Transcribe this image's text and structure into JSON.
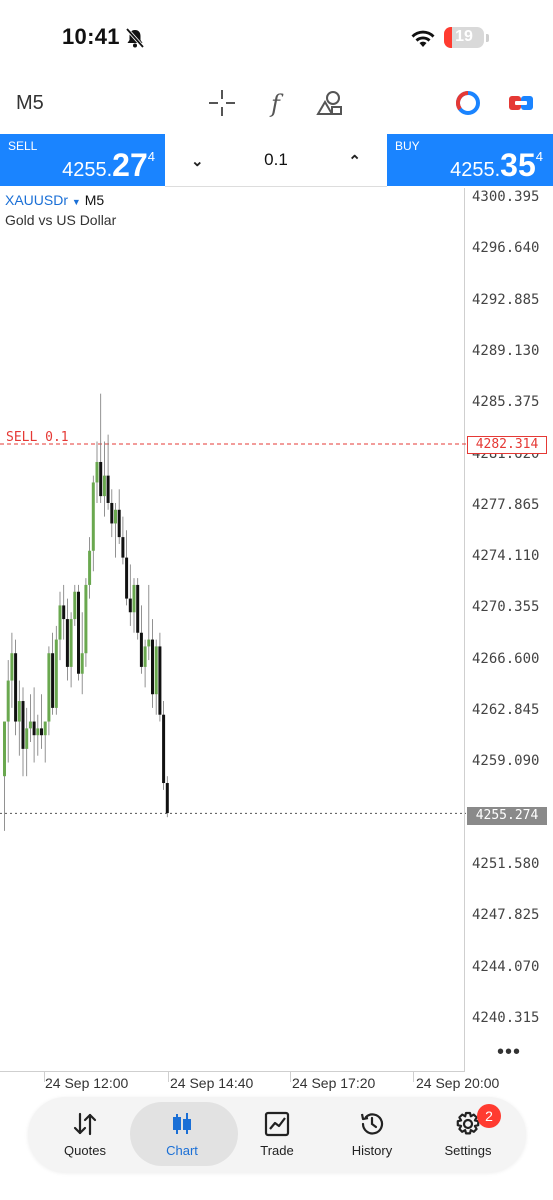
{
  "status_bar": {
    "time": "10:41",
    "battery": "19"
  },
  "toolbar": {
    "timeframe": "M5"
  },
  "trade": {
    "sell": {
      "label": "SELL",
      "price_a": "4255.",
      "price_b": "27",
      "price_c": "4"
    },
    "buy": {
      "label": "BUY",
      "price_a": "4255.",
      "price_b": "35",
      "price_c": "4"
    },
    "lot": "0.1"
  },
  "chart_data": {
    "type": "candlestick",
    "symbol": "XAUUSDr",
    "timeframe": "M5",
    "description": "Gold vs US Dollar",
    "y_ticks": [
      "4300.395",
      "4296.640",
      "4292.885",
      "4289.130",
      "4285.375",
      "4281.620",
      "4277.865",
      "4274.110",
      "4270.355",
      "4266.600",
      "4262.845",
      "4259.090",
      "4255.274",
      "4251.580",
      "4247.825",
      "4244.070",
      "4240.315"
    ],
    "y_range": [
      4238.0,
      4301.0
    ],
    "x_ticks": [
      "24 Sep 12:00",
      "24 Sep 14:40",
      "24 Sep 17:20",
      "24 Sep 20:00"
    ],
    "sell_order": {
      "label": "SELL 0.1",
      "price": "4282.314",
      "value": 4282.314
    },
    "current_price": {
      "label": "4255.274",
      "value": 4255.274
    },
    "candles": [
      [
        4258.0,
        4262.0,
        4254.0,
        4262.0
      ],
      [
        4262.0,
        4266.5,
        4259.0,
        4265.0
      ],
      [
        4265.0,
        4268.5,
        4263.0,
        4267.0
      ],
      [
        4267.0,
        4268.0,
        4261.0,
        4262.0
      ],
      [
        4262.0,
        4265.0,
        4259.5,
        4263.5
      ],
      [
        4263.5,
        4264.5,
        4258.0,
        4260.0
      ],
      [
        4260.0,
        4263.0,
        4258.0,
        4261.5
      ],
      [
        4261.5,
        4264.0,
        4260.5,
        4262.0
      ],
      [
        4262.0,
        4264.5,
        4259.0,
        4261.0
      ],
      [
        4261.0,
        4262.5,
        4259.5,
        4261.5
      ],
      [
        4261.5,
        4264.0,
        4260.0,
        4261.0
      ],
      [
        4261.0,
        4262.0,
        4259.0,
        4262.0
      ],
      [
        4262.0,
        4267.5,
        4261.0,
        4267.0
      ],
      [
        4267.0,
        4268.5,
        4262.5,
        4263.0
      ],
      [
        4263.0,
        4269.0,
        4262.5,
        4268.0
      ],
      [
        4268.0,
        4271.5,
        4266.5,
        4270.5
      ],
      [
        4270.5,
        4272.0,
        4268.0,
        4269.5
      ],
      [
        4269.5,
        4271.0,
        4265.0,
        4266.0
      ],
      [
        4266.0,
        4270.0,
        4264.5,
        4269.5
      ],
      [
        4269.5,
        4272.0,
        4269.0,
        4271.5
      ],
      [
        4271.5,
        4272.0,
        4265.0,
        4265.5
      ],
      [
        4265.5,
        4270.0,
        4264.0,
        4267.0
      ],
      [
        4267.0,
        4272.5,
        4266.0,
        4272.0
      ],
      [
        4272.0,
        4275.5,
        4271.0,
        4274.5
      ],
      [
        4274.5,
        4280.0,
        4273.0,
        4279.5
      ],
      [
        4279.5,
        4282.5,
        4278.0,
        4281.0
      ],
      [
        4281.0,
        4286.0,
        4278.0,
        4278.5
      ],
      [
        4278.5,
        4282.5,
        4277.0,
        4280.0
      ],
      [
        4280.0,
        4283.0,
        4277.5,
        4278.0
      ],
      [
        4278.0,
        4279.0,
        4275.5,
        4276.5
      ],
      [
        4276.5,
        4278.0,
        4274.0,
        4277.5
      ],
      [
        4277.5,
        4279.0,
        4275.0,
        4275.5
      ],
      [
        4275.5,
        4277.0,
        4273.5,
        4274.0
      ],
      [
        4274.0,
        4276.0,
        4270.5,
        4271.0
      ],
      [
        4271.0,
        4273.5,
        4269.0,
        4270.0
      ],
      [
        4270.0,
        4272.5,
        4268.5,
        4272.0
      ],
      [
        4272.0,
        4272.5,
        4268.0,
        4268.5
      ],
      [
        4268.5,
        4270.5,
        4265.5,
        4266.0
      ],
      [
        4266.0,
        4268.0,
        4264.5,
        4267.5
      ],
      [
        4267.5,
        4272.0,
        4266.5,
        4268.0
      ],
      [
        4268.0,
        4269.5,
        4263.0,
        4264.0
      ],
      [
        4264.0,
        4268.0,
        4262.5,
        4267.5
      ],
      [
        4267.5,
        4268.5,
        4262.0,
        4262.5
      ],
      [
        4262.5,
        4263.5,
        4257.0,
        4257.5
      ],
      [
        4257.5,
        4258.0,
        4255.0,
        4255.3
      ]
    ]
  },
  "tabs": [
    {
      "label": "Quotes"
    },
    {
      "label": "Chart"
    },
    {
      "label": "Trade"
    },
    {
      "label": "History"
    },
    {
      "label": "Settings"
    }
  ],
  "settings_badge": "2",
  "colors": {
    "accent": "#1a84ff",
    "bull": "#6aa84f",
    "bear": "#111111",
    "sell_line": "#e53935"
  }
}
